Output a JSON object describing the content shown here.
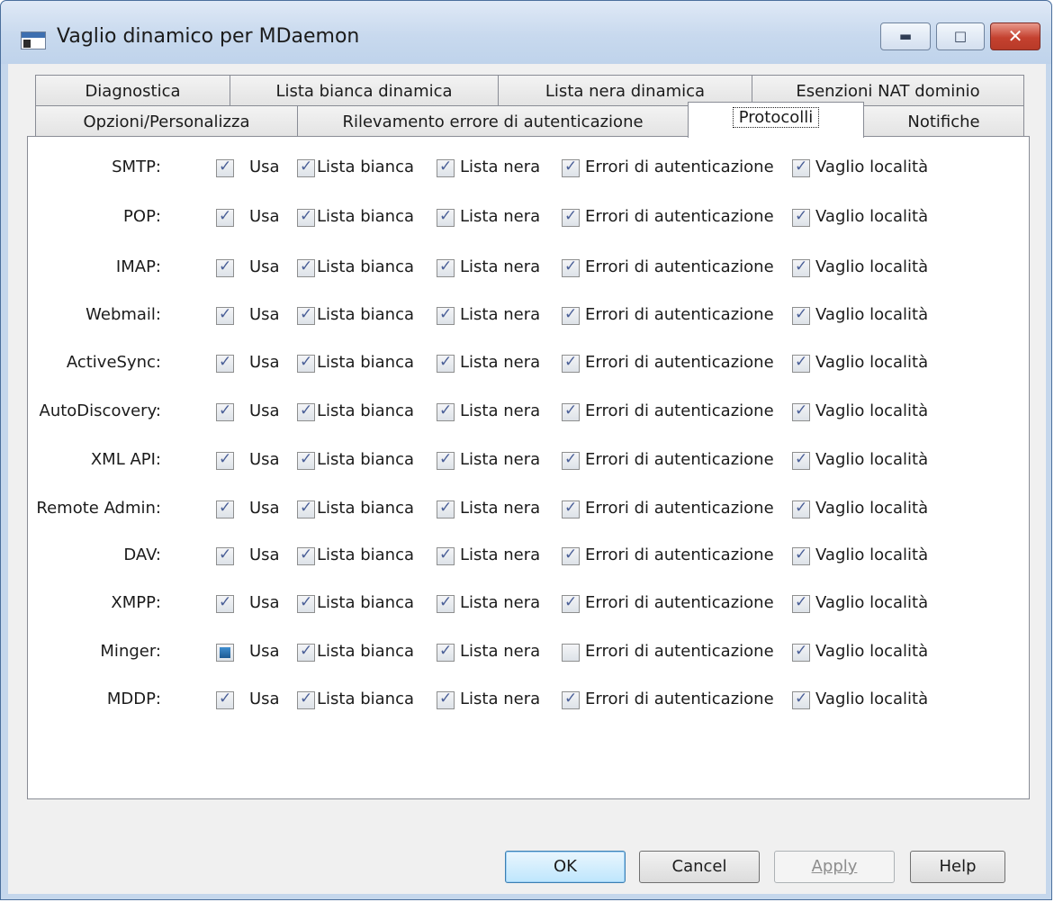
{
  "window": {
    "title": "Vaglio dinamico per MDaemon"
  },
  "tabs_row1": [
    "Diagnostica",
    "Lista bianca dinamica",
    "Lista nera dinamica",
    "Esenzioni NAT dominio"
  ],
  "tabs_row2": [
    "Opzioni/Personalizza",
    "Rilevamento errore di autenticazione",
    "Protocolli",
    "Notifiche"
  ],
  "active_tab": "Protocolli",
  "columns": {
    "use": "Usa",
    "whitelist": "Lista bianca",
    "blacklist": "Lista nera",
    "auth": "Errori di autenticazione",
    "location": "Vaglio località"
  },
  "protocols": [
    {
      "label": "SMTP:",
      "use": "checked",
      "whitelist": true,
      "blacklist": true,
      "auth": true,
      "location": true
    },
    {
      "label": "POP:",
      "use": "checked",
      "whitelist": true,
      "blacklist": true,
      "auth": true,
      "location": true
    },
    {
      "label": "IMAP:",
      "use": "checked",
      "whitelist": true,
      "blacklist": true,
      "auth": true,
      "location": true
    },
    {
      "label": "Webmail:",
      "use": "checked",
      "whitelist": true,
      "blacklist": true,
      "auth": true,
      "location": true
    },
    {
      "label": "ActiveSync:",
      "use": "checked",
      "whitelist": true,
      "blacklist": true,
      "auth": true,
      "location": true
    },
    {
      "label": "AutoDiscovery:",
      "use": "checked",
      "whitelist": true,
      "blacklist": true,
      "auth": true,
      "location": true
    },
    {
      "label": "XML API:",
      "use": "checked",
      "whitelist": true,
      "blacklist": true,
      "auth": true,
      "location": true
    },
    {
      "label": "Remote Admin:",
      "use": "checked",
      "whitelist": true,
      "blacklist": true,
      "auth": true,
      "location": true
    },
    {
      "label": "DAV:",
      "use": "checked",
      "whitelist": true,
      "blacklist": true,
      "auth": true,
      "location": true
    },
    {
      "label": "XMPP:",
      "use": "checked",
      "whitelist": true,
      "blacklist": true,
      "auth": true,
      "location": true
    },
    {
      "label": "Minger:",
      "use": "indeterminate",
      "whitelist": true,
      "blacklist": true,
      "auth": false,
      "location": true
    },
    {
      "label": "MDDP:",
      "use": "checked",
      "whitelist": true,
      "blacklist": true,
      "auth": true,
      "location": true
    }
  ],
  "buttons": {
    "ok": "OK",
    "cancel": "Cancel",
    "apply": "Apply",
    "help": "Help"
  }
}
